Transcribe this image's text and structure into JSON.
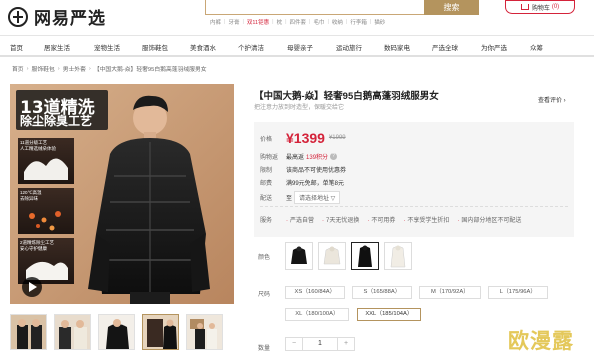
{
  "header": {
    "logo_text": "网易严选",
    "search_button": "搜索",
    "hot_words": [
      "内裤",
      "牙膏",
      "双11钜惠",
      "枕",
      "四件套",
      "毛巾",
      "收纳",
      "行李箱",
      "猫砂"
    ],
    "cart_label": "购物车",
    "cart_count": "(0)"
  },
  "nav": {
    "items": [
      "首页",
      "居家生活",
      "宠物生活",
      "服饰鞋包",
      "美食酒水",
      "个护清洁",
      "母婴亲子",
      "运动旅行",
      "数码家电",
      "严选全球",
      "为你严选",
      "众筹"
    ]
  },
  "breadcrumb": [
    "首页",
    "服饰鞋包",
    "男士外套",
    "【中国大鹅-焱】轻奢95白鹅高蓬羽绒服男女"
  ],
  "gallery": {
    "headline_1": "13道精洗",
    "headline_2": "除尘除臭工艺",
    "feature_1_line1": "11道分级工艺",
    "feature_1_line2": "人工精选绒朵体验",
    "feature_2_line1": "120℃高温",
    "feature_2_line2": "去除异味",
    "feature_3_line1": "2道精炼除尘工艺",
    "feature_3_line2": "安心守护健康"
  },
  "product": {
    "title": "【中国大鹅-焱】轻奢95白鹅高蓬羽绒服男女",
    "subtitle": "把注意力放到时造型，保暖交给它",
    "reviews_link": "查看评价 ›",
    "price_label": "价格",
    "price": "¥1399",
    "price_old": "¥1999",
    "points_label": "购物返",
    "points_text_pre": "最高返",
    "points_value": "139积分",
    "limit_label": "限制",
    "limit_text": "该商品不可使用优惠券",
    "shipping_fee_label": "邮费",
    "shipping_fee_text": "满99元免邮，单笔8元",
    "delivery_label": "配送",
    "delivery_to": "至",
    "delivery_select": "请选择地址 ▽",
    "service_label": "服务",
    "services": [
      "严选自营",
      "7天无忧退换",
      "不可用券",
      "不享受学生折扣",
      "国内部分地区不可配送"
    ],
    "color_label": "颜色",
    "size_label": "尺码",
    "sizes": [
      "XS（160/84A）",
      "S（165/88A）",
      "M（170/92A）",
      "L（175/96A）",
      "XL（180/100A）",
      "XXL（185/104A）"
    ],
    "selected_size_index": 5,
    "qty_label": "数量",
    "qty_value": "1",
    "qty_minus": "−",
    "qty_plus": "+"
  },
  "watermark": "欧漫露",
  "colors": {
    "brand": "#b4945e",
    "price_red": "#d4233a"
  }
}
